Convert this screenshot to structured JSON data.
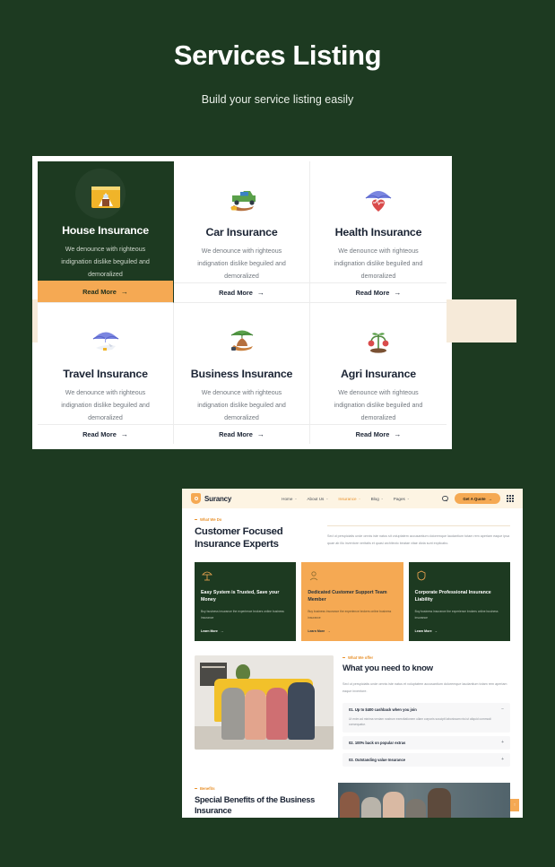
{
  "hero": {
    "title": "Services Listing",
    "subtitle": "Build your service listing easily"
  },
  "colors": {
    "page_background": "#1d3a21",
    "accent_orange": "#f5a953",
    "card_dark_green": "#1d3a21",
    "band_cream": "#f6ead9",
    "nav_cream": "#fdf4e3",
    "heading_dark": "#1b2434"
  },
  "services": {
    "shared_description": "We denounce with righteous indignation dislike beguiled and demoralized",
    "read_more_label": "Read More",
    "read_more_arrow": "→",
    "cards": [
      {
        "title": "House Insurance",
        "icon": "house-insurance-icon",
        "highlighted": true
      },
      {
        "title": "Car Insurance",
        "icon": "car-insurance-icon",
        "highlighted": false
      },
      {
        "title": "Health Insurance",
        "icon": "health-insurance-icon",
        "highlighted": false
      },
      {
        "title": "Travel Insurance",
        "icon": "travel-insurance-icon",
        "highlighted": false
      },
      {
        "title": "Business Insurance",
        "icon": "business-insurance-icon",
        "highlighted": false
      },
      {
        "title": "Agri Insurance",
        "icon": "agri-insurance-icon",
        "highlighted": false
      }
    ]
  },
  "mock": {
    "nav": {
      "brand": "Surancy",
      "brand_icon": "shield-icon",
      "items": [
        {
          "label": "Home",
          "active": false
        },
        {
          "label": "About Us",
          "active": false
        },
        {
          "label": "Insurance",
          "active": true
        },
        {
          "label": "Blog",
          "active": false
        },
        {
          "label": "Pages",
          "active": false
        }
      ],
      "caret": "⌄",
      "search_icon": "search-icon",
      "quote_button": "Get A Quote",
      "quote_arrow": "→",
      "grid_icon": "grid-menu-icon"
    },
    "what_we_do": {
      "eyebrow": "What We Do",
      "heading": "Customer Focused Insurance Experts",
      "paragraph": "Sed ut perspiciatis unde omnis iste natus sit voluptatem accusantium doloremque laudantium totam rem aperiam eaque ipsa quae ab illo inventore veritatis et quasi architecto beatae vitae dicta sunt explicabo."
    },
    "feature_cards": [
      {
        "icon": "umbrella-shield-icon",
        "title": "Easy System is Trusted, Save your Money",
        "description": "Buy business insurance the experience brokers online business insurance",
        "link": "Learn More",
        "arrow": "→",
        "style": "dark"
      },
      {
        "icon": "support-team-icon",
        "title": "Dedicated Customer Support Team Member",
        "description": "Buy business insurance the experience brokers online business insurance",
        "link": "Learn More",
        "arrow": "→",
        "style": "orange"
      },
      {
        "icon": "liability-icon",
        "title": "Corporate Professional Insurance Liability",
        "description": "Buy business insurance the experience brokers online business insurance",
        "link": "Learn More",
        "arrow": "→",
        "style": "dark"
      }
    ],
    "what_you_need": {
      "eyebrow": "What We offer",
      "heading": "What you need to know",
      "paragraph": "Sed ut perspiciatis unde omnis iste natus et voluptatem accusantium doloremque laudantium totam rem aperiam eaque inventore.",
      "photo_alt": "family-on-yellow-couch-photo",
      "accordion": [
        {
          "question": "01. Up to $400 cashback when you join",
          "answer": "Ut enim ad minima veniam nostrum exercitationem ullam corporis suscipit laboriosam nisi ut aliquid commodi consequatur.",
          "toggle": "−",
          "open": true
        },
        {
          "question": "02. 100% back on popular extras",
          "answer": "",
          "toggle": "+",
          "open": false
        },
        {
          "question": "03. Outstanding value Insurance",
          "answer": "",
          "toggle": "+",
          "open": false
        }
      ]
    },
    "benefits": {
      "eyebrow": "Benefits",
      "heading": "Special Benefits of the Business Insurance",
      "photo_alt": "business-team-meeting-photo"
    },
    "scroll_top": {
      "icon": "arrow-up-icon",
      "glyph": "↑"
    }
  }
}
